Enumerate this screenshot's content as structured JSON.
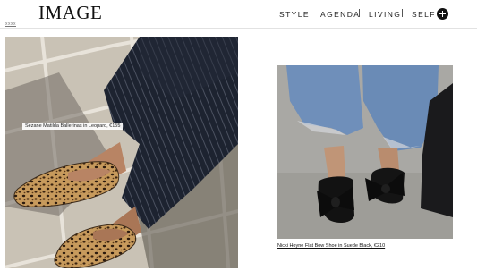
{
  "header": {
    "logo": "IMAGE",
    "nav": [
      {
        "label": "STYLE",
        "active": true
      },
      {
        "label": "AGENDA",
        "active": false
      },
      {
        "label": "LIVING",
        "active": false
      },
      {
        "label": "SELF",
        "active": false
      }
    ],
    "plus_icon": "plus-circle-icon",
    "stub_text": "xxxx"
  },
  "article": {
    "images": [
      {
        "caption": "Sézane Matilda Ballerinas in Leopard, €155"
      },
      {
        "caption": "Nicki Hoyne Flat Bow Shoe in Suede Black, €210"
      }
    ]
  },
  "colors": {
    "accent": "#111111",
    "divider": "#e2e2e2"
  }
}
